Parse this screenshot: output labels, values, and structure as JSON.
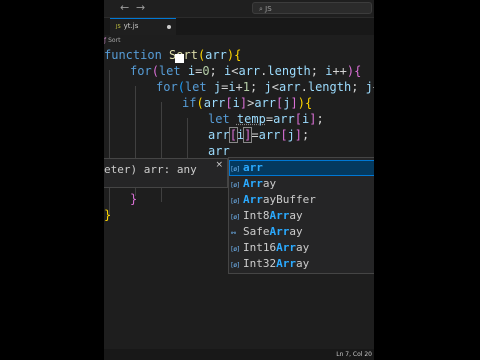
{
  "titlebar": {
    "back_icon": "←",
    "forward_icon": "→",
    "search_text": "JS"
  },
  "tab": {
    "icon": "JS",
    "label": "yt.js"
  },
  "breadcrumb": {
    "icon": "ƒ",
    "label": "Sort"
  },
  "hover": {
    "text": "eter) arr: any",
    "close": "×"
  },
  "suggestions": {
    "items": [
      {
        "icon": "[ø]",
        "hl": "arr",
        "rest": "",
        "pre": ""
      },
      {
        "icon": "[ø]",
        "hl": "Arr",
        "rest": "ay",
        "pre": ""
      },
      {
        "icon": "[ø]",
        "hl": "Arr",
        "rest": "ayBuffer",
        "pre": ""
      },
      {
        "icon": "[ø]",
        "hl": "Arr",
        "rest": "ay",
        "pre": "Int8"
      },
      {
        "icon": "⚯",
        "hl": "Arr",
        "rest": "ay",
        "pre": "Safe"
      },
      {
        "icon": "[ø]",
        "hl": "Arr",
        "rest": "ay",
        "pre": "Int16"
      },
      {
        "icon": "[ø]",
        "hl": "Arr",
        "rest": "ay",
        "pre": "Int32"
      }
    ]
  },
  "status": {
    "position": "Ln 7, Col 20"
  },
  "colors": {
    "accent": "#0078d4",
    "editor_bg": "#1e1e1e",
    "highlight": "#2aaaff"
  }
}
